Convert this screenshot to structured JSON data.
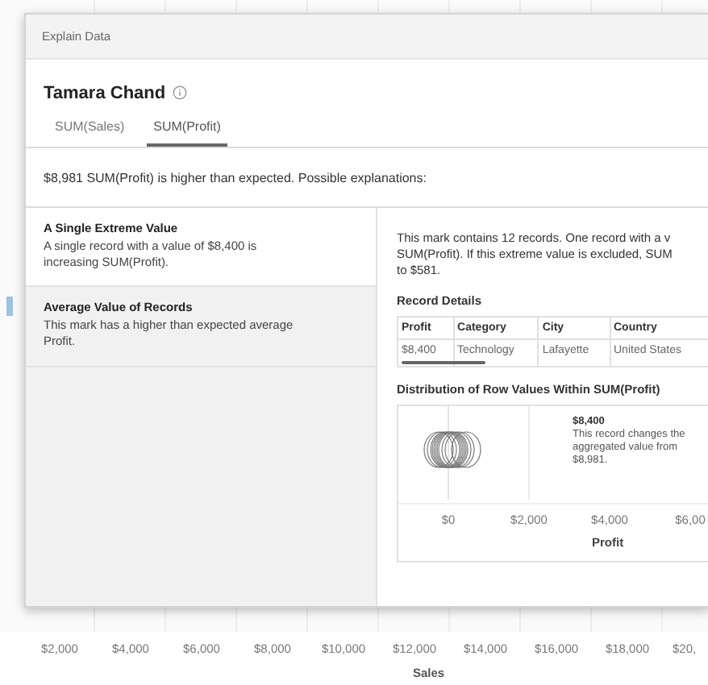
{
  "background_chart": {
    "xticks": [
      "$2,000",
      "$4,000",
      "$6,000",
      "$8,000",
      "$10,000",
      "$12,000",
      "$14,000",
      "$16,000",
      "$18,000",
      "$20,"
    ],
    "xlabel": "Sales"
  },
  "dialog": {
    "title": "Explain Data",
    "mark_name": "Tamara Chand",
    "tabs": [
      {
        "label": "SUM(Sales)",
        "selected": false
      },
      {
        "label": "SUM(Profit)",
        "selected": true
      }
    ],
    "summary": "$8,981 SUM(Profit) is higher than expected. Possible explanations:",
    "explanations": [
      {
        "title": "A Single Extreme Value",
        "description": "A single record with a value of $8,400 is increasing SUM(Profit).",
        "selected": true
      },
      {
        "title": "Average Value of Records",
        "description": "This mark has a higher than expected average Profit.",
        "selected": false
      }
    ],
    "detail_lines": [
      "This mark contains 12 records. One record with a v",
      "SUM(Profit). If this extreme value is excluded, SUM",
      "to $581."
    ],
    "record_details": {
      "heading": "Record Details",
      "columns": [
        "Profit",
        "Category",
        "City",
        "Country"
      ],
      "rows": [
        [
          "$8,400",
          "Technology",
          "Lafayette",
          "United States"
        ]
      ]
    },
    "distribution": {
      "heading": "Distribution of Row Values Within SUM(Profit)",
      "axis_labels": [
        "$0",
        "$2,000",
        "$4,000",
        "$6,00"
      ],
      "xlabel": "Profit",
      "annotation": {
        "title": "$8,400",
        "lines": [
          "This record changes the",
          "aggregated value from",
          "$8,981."
        ]
      }
    }
  }
}
